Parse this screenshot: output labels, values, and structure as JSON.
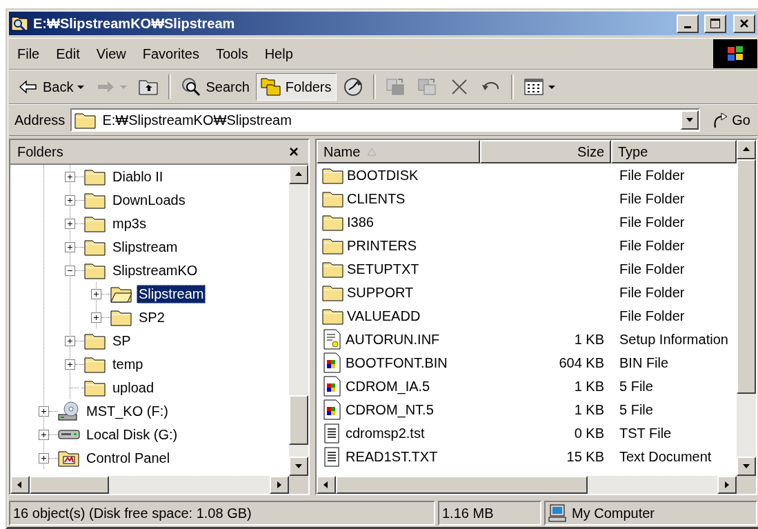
{
  "window": {
    "title": "E:₩SlipstreamKO₩Slipstream"
  },
  "menu": [
    {
      "label": "File"
    },
    {
      "label": "Edit"
    },
    {
      "label": "View"
    },
    {
      "label": "Favorites"
    },
    {
      "label": "Tools"
    },
    {
      "label": "Help"
    }
  ],
  "toolbar": [
    {
      "kind": "back",
      "label": "Back",
      "dropdown": true,
      "disabled": false,
      "pressed": false
    },
    {
      "kind": "forward",
      "dropdown": true,
      "disabled": true,
      "pressed": false
    },
    {
      "kind": "up",
      "dropdown": false,
      "disabled": false,
      "pressed": false
    },
    {
      "kind": "separator"
    },
    {
      "kind": "search",
      "label": "Search",
      "dropdown": false,
      "disabled": false,
      "pressed": false
    },
    {
      "kind": "folders",
      "label": "Folders",
      "dropdown": false,
      "disabled": false,
      "pressed": true
    },
    {
      "kind": "history",
      "dropdown": false,
      "disabled": false,
      "pressed": false
    },
    {
      "kind": "separator"
    },
    {
      "kind": "move",
      "dropdown": false,
      "disabled": false,
      "pressed": false
    },
    {
      "kind": "copy",
      "dropdown": false,
      "disabled": false,
      "pressed": false
    },
    {
      "kind": "delete",
      "dropdown": false,
      "disabled": false,
      "pressed": false
    },
    {
      "kind": "undo",
      "dropdown": false,
      "disabled": false,
      "pressed": false
    },
    {
      "kind": "separator"
    },
    {
      "kind": "views",
      "dropdown": true,
      "disabled": false,
      "pressed": false
    }
  ],
  "address": {
    "label": "Address",
    "value": "E:₩SlipstreamKO₩Slipstream",
    "go": "Go"
  },
  "folders_pane": {
    "title": "Folders",
    "close": "×"
  },
  "tree": [
    {
      "children": [
        {
          "children": [
            {
              "label": "Diablo II",
              "kind": "folder",
              "expandable": true,
              "selected": false
            },
            {
              "label": "DownLoads",
              "kind": "folder",
              "expandable": true,
              "selected": false
            },
            {
              "label": "mp3s",
              "kind": "folder",
              "expandable": true,
              "selected": false
            },
            {
              "label": "Slipstream",
              "kind": "folder",
              "expandable": true,
              "selected": false
            },
            {
              "label": "SlipstreamKO",
              "kind": "folder",
              "expandable": true,
              "selected": false,
              "children": [
                {
                  "label": "Slipstream",
                  "kind": "folder",
                  "expandable": true,
                  "selected": true
                },
                {
                  "label": "SP2",
                  "kind": "folder",
                  "expandable": true,
                  "selected": false
                }
              ]
            },
            {
              "label": "SP",
              "kind": "folder",
              "expandable": true,
              "selected": false
            },
            {
              "label": "temp",
              "kind": "folder",
              "expandable": true,
              "selected": false
            },
            {
              "label": "upload",
              "kind": "folder",
              "expandable": false,
              "selected": false
            }
          ]
        },
        {
          "label": "MST_KO (F:)",
          "kind": "cd-drive",
          "expandable": true,
          "selected": false
        },
        {
          "label": "Local Disk (G:)",
          "kind": "disk",
          "expandable": true,
          "selected": false
        },
        {
          "label": "Control Panel",
          "kind": "control-panel",
          "expandable": true,
          "selected": false
        }
      ]
    }
  ],
  "columns": [
    {
      "label": "Name",
      "sorted": true
    },
    {
      "label": "Size",
      "sorted": false
    },
    {
      "label": "Type",
      "sorted": false
    }
  ],
  "files": [
    {
      "name": "BOOTDISK",
      "kind": "folder",
      "type": "File Folder"
    },
    {
      "name": "CLIENTS",
      "kind": "folder",
      "type": "File Folder"
    },
    {
      "name": "I386",
      "kind": "folder",
      "type": "File Folder"
    },
    {
      "name": "PRINTERS",
      "kind": "folder",
      "type": "File Folder"
    },
    {
      "name": "SETUPTXT",
      "kind": "folder",
      "type": "File Folder"
    },
    {
      "name": "SUPPORT",
      "kind": "folder",
      "type": "File Folder"
    },
    {
      "name": "VALUEADD",
      "kind": "folder",
      "type": "File Folder"
    },
    {
      "name": "AUTORUN.INF",
      "kind": "setup",
      "size": "1 KB",
      "type": "Setup Information"
    },
    {
      "name": "BOOTFONT.BIN",
      "kind": "binary",
      "size": "604 KB",
      "type": "BIN File"
    },
    {
      "name": "CDROM_IA.5",
      "kind": "binary",
      "size": "1 KB",
      "type": "5 File"
    },
    {
      "name": "CDROM_NT.5",
      "kind": "binary",
      "size": "1 KB",
      "type": "5 File"
    },
    {
      "name": "cdromsp2.tst",
      "kind": "text",
      "size": "0 KB",
      "type": "TST File"
    },
    {
      "name": "READ1ST.TXT",
      "kind": "text",
      "size": "15 KB",
      "type": "Text Document"
    }
  ],
  "status_bar": {
    "objects": "16 object(s) (Disk free space: 1.08 GB)",
    "size": "1.16 MB",
    "zone": "My Computer"
  }
}
